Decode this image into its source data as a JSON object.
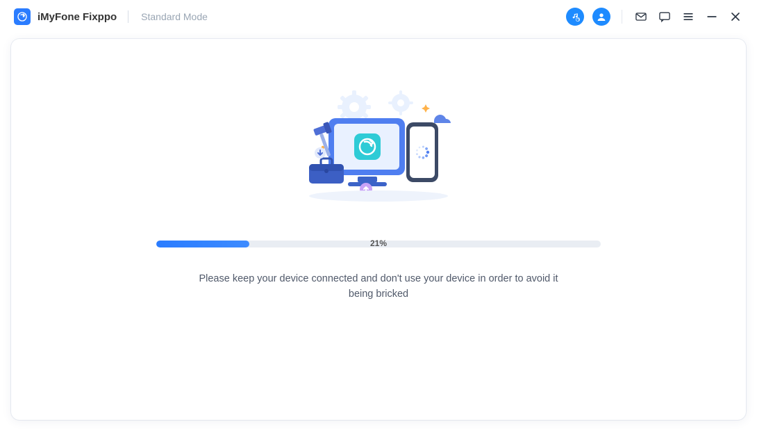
{
  "header": {
    "app_name": "iMyFone Fixppo",
    "mode_label": "Standard Mode"
  },
  "progress": {
    "percent": 21,
    "percent_label": "21%"
  },
  "message": "Please keep your device connected and don't use your device in order to avoid it being bricked",
  "colors": {
    "accent": "#2a7cff",
    "track": "#e9edf3"
  }
}
